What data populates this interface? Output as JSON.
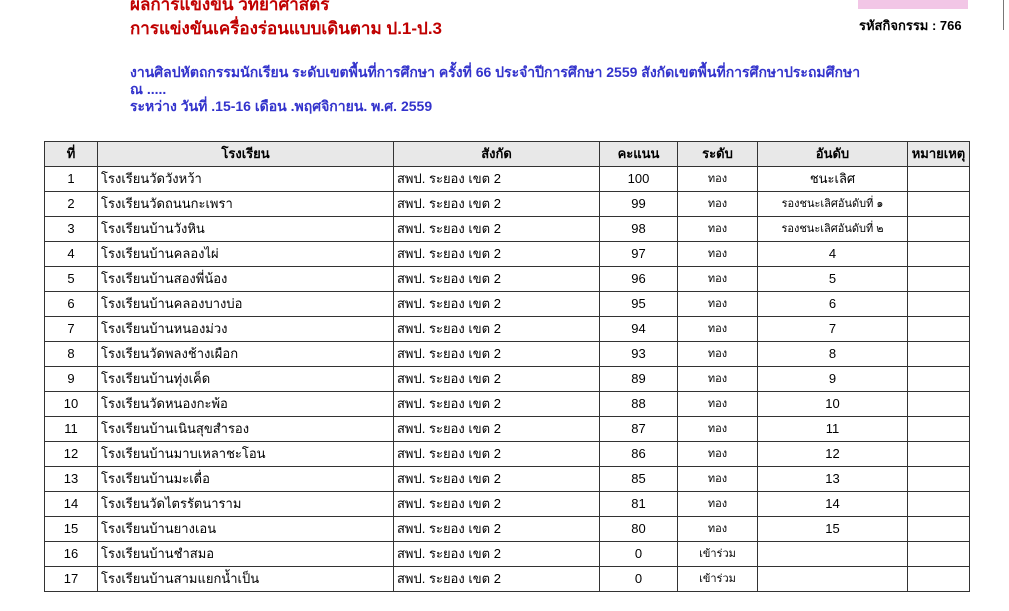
{
  "header": {
    "title_cut": "ผลการแข่งขัน วิทยาศาสตร์",
    "title": "การแข่งขันเครื่องร่อนแบบเดินตาม ป.1-ป.3",
    "activity_code": "รหัสกิจกรรม : 766",
    "event_line1": "งานศิลปหัตถกรรมนักเรียน ระดับเขตพื้นที่การศึกษา ครั้งที่ 66 ประจำปีการศึกษา 2559 สังกัดเขตพื้นที่การศึกษาประถมศึกษา",
    "event_line2": "ณ .....",
    "event_line3": "ระหว่าง วันที่ .15-16 เดือน .พฤศจิกายน. พ.ศ. 2559"
  },
  "table": {
    "headers": [
      "ที่",
      "โรงเรียน",
      "สังกัด",
      "คะแนน",
      "ระดับ",
      "อันดับ",
      "หมายเหตุ"
    ],
    "rows": [
      {
        "no": "1",
        "school": "โรงเรียนวัดวังหว้า",
        "affil": "สพป. ระยอง เขต 2",
        "score": "100",
        "level": "ทอง",
        "rank": "ชนะเลิศ",
        "note": ""
      },
      {
        "no": "2",
        "school": "โรงเรียนวัดถนนกะเพรา",
        "affil": "สพป. ระยอง เขต 2",
        "score": "99",
        "level": "ทอง",
        "rank": "รองชนะเลิศอันดับที่ ๑",
        "note": ""
      },
      {
        "no": "3",
        "school": "โรงเรียนบ้านวังหิน",
        "affil": "สพป. ระยอง เขต 2",
        "score": "98",
        "level": "ทอง",
        "rank": "รองชนะเลิศอันดับที่ ๒",
        "note": ""
      },
      {
        "no": "4",
        "school": "โรงเรียนบ้านคลองไผ่",
        "affil": "สพป. ระยอง เขต 2",
        "score": "97",
        "level": "ทอง",
        "rank": "4",
        "note": ""
      },
      {
        "no": "5",
        "school": "โรงเรียนบ้านสองพี่น้อง",
        "affil": "สพป. ระยอง เขต 2",
        "score": "96",
        "level": "ทอง",
        "rank": "5",
        "note": ""
      },
      {
        "no": "6",
        "school": "โรงเรียนบ้านคลองบางบ่อ",
        "affil": "สพป. ระยอง เขต 2",
        "score": "95",
        "level": "ทอง",
        "rank": "6",
        "note": ""
      },
      {
        "no": "7",
        "school": "โรงเรียนบ้านหนองม่วง",
        "affil": "สพป. ระยอง เขต 2",
        "score": "94",
        "level": "ทอง",
        "rank": "7",
        "note": ""
      },
      {
        "no": "8",
        "school": "โรงเรียนวัดพลงช้างเผือก",
        "affil": "สพป. ระยอง เขต 2",
        "score": "93",
        "level": "ทอง",
        "rank": "8",
        "note": ""
      },
      {
        "no": "9",
        "school": "โรงเรียนบ้านทุ่งเค็ด",
        "affil": "สพป. ระยอง เขต 2",
        "score": "89",
        "level": "ทอง",
        "rank": "9",
        "note": ""
      },
      {
        "no": "10",
        "school": "โรงเรียนวัดหนองกะพ้อ",
        "affil": "สพป. ระยอง เขต 2",
        "score": "88",
        "level": "ทอง",
        "rank": "10",
        "note": ""
      },
      {
        "no": "11",
        "school": "โรงเรียนบ้านเนินสุขสำรอง",
        "affil": "สพป. ระยอง เขต 2",
        "score": "87",
        "level": "ทอง",
        "rank": "11",
        "note": ""
      },
      {
        "no": "12",
        "school": "โรงเรียนบ้านมาบเหลาชะโอน",
        "affil": "สพป. ระยอง เขต 2",
        "score": "86",
        "level": "ทอง",
        "rank": "12",
        "note": ""
      },
      {
        "no": "13",
        "school": "โรงเรียนบ้านมะเดื่อ",
        "affil": "สพป. ระยอง เขต 2",
        "score": "85",
        "level": "ทอง",
        "rank": "13",
        "note": ""
      },
      {
        "no": "14",
        "school": "โรงเรียนวัดไตรรัตนาราม",
        "affil": "สพป. ระยอง เขต 2",
        "score": "81",
        "level": "ทอง",
        "rank": "14",
        "note": ""
      },
      {
        "no": "15",
        "school": "โรงเรียนบ้านยางเอน",
        "affil": "สพป. ระยอง เขต 2",
        "score": "80",
        "level": "ทอง",
        "rank": "15",
        "note": ""
      },
      {
        "no": "16",
        "school": "โรงเรียนบ้านชำสมอ",
        "affil": "สพป. ระยอง เขต 2",
        "score": "0",
        "level": "เข้าร่วม",
        "rank": "",
        "note": ""
      },
      {
        "no": "17",
        "school": "โรงเรียนบ้านสามแยกน้ำเป็น",
        "affil": "สพป. ระยอง เขต 2",
        "score": "0",
        "level": "เข้าร่วม",
        "rank": "",
        "note": ""
      }
    ]
  }
}
